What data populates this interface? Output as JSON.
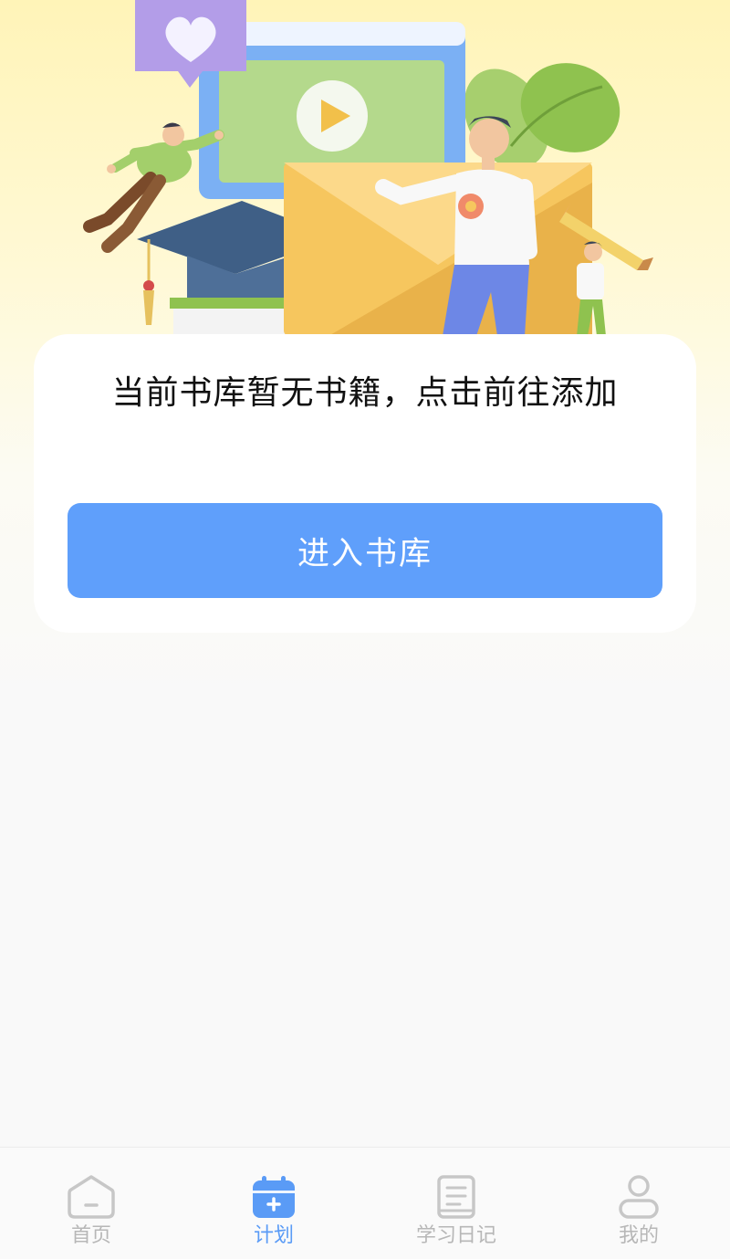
{
  "empty_state": {
    "message": "当前书库暂无书籍，点击前往添加",
    "button_label": "进入书库"
  },
  "tabbar": {
    "items": [
      {
        "label": "首页",
        "icon": "home-icon",
        "active": false
      },
      {
        "label": "计划",
        "icon": "calendar-plus-icon",
        "active": true
      },
      {
        "label": "学习日记",
        "icon": "book-icon",
        "active": false
      },
      {
        "label": "我的",
        "icon": "user-icon",
        "active": false
      }
    ]
  },
  "colors": {
    "primary": "#5f9ffb",
    "tab_active": "#5a9bf6",
    "tab_inactive": "#b7b7b7"
  }
}
